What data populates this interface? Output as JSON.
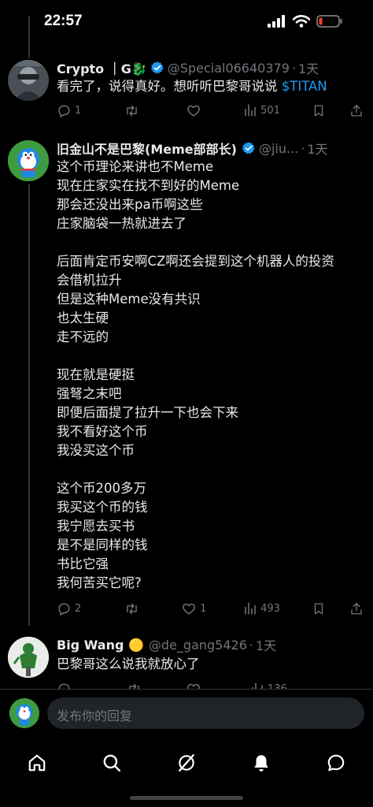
{
  "status_bar": {
    "time": "22:57"
  },
  "tweets": [
    {
      "name": "Crypto ｜G🐉",
      "handle": "@Special06640379",
      "dot": "·",
      "time": "1天",
      "text": "看完了，说得真好。想听听巴黎哥说说 ",
      "link": "$TITAN",
      "replies": "1",
      "views": "501"
    },
    {
      "name": "旧金山不是巴黎(Meme部部长)",
      "handle": "@jiu...",
      "dot": "·",
      "time": "1天",
      "text": "这个币理论来讲也不Meme\n现在庄家实在找不到好的Meme\n那会还没出来pa币啊这些\n庄家脑袋一热就进去了\n\n后面肯定币安啊CZ啊还会提到这个机器人的投资\n会借机拉升\n但是这种Meme没有共识\n也太生硬\n走不远的\n\n现在就是硬挺\n强弩之末吧\n即便后面提了拉升一下也会下来\n我不看好这个币\n我没买这个币\n\n这个币200多万\n我买这个币的钱\n我宁愿去买书\n是不是同样的钱\n书比它强\n我何苦买它呢?",
      "replies": "2",
      "likes": "1",
      "views": "493"
    },
    {
      "name": "Big Wang 🟡",
      "handle": "@de_gang5426",
      "dot": "·",
      "time": "1天",
      "text": "巴黎哥这么说我就放心了",
      "views": "136"
    }
  ],
  "composer": {
    "placeholder": "发布你的回复"
  },
  "icons": {
    "reply": "reply-icon",
    "retweet": "retweet-icon",
    "like": "heart-icon",
    "views": "views-icon",
    "bookmark": "bookmark-icon",
    "share": "share-icon",
    "verified": "verified-badge-icon",
    "nav": [
      "home-icon",
      "search-icon",
      "grok-icon",
      "notifications-icon",
      "messages-icon"
    ]
  },
  "colors": {
    "background": "#000000",
    "text": "#e7e9ea",
    "secondary": "#71767b",
    "link": "#1d9bf0",
    "verified": "#1d9bf0",
    "composer_bg": "#202327",
    "battery": "#ff3b30"
  }
}
